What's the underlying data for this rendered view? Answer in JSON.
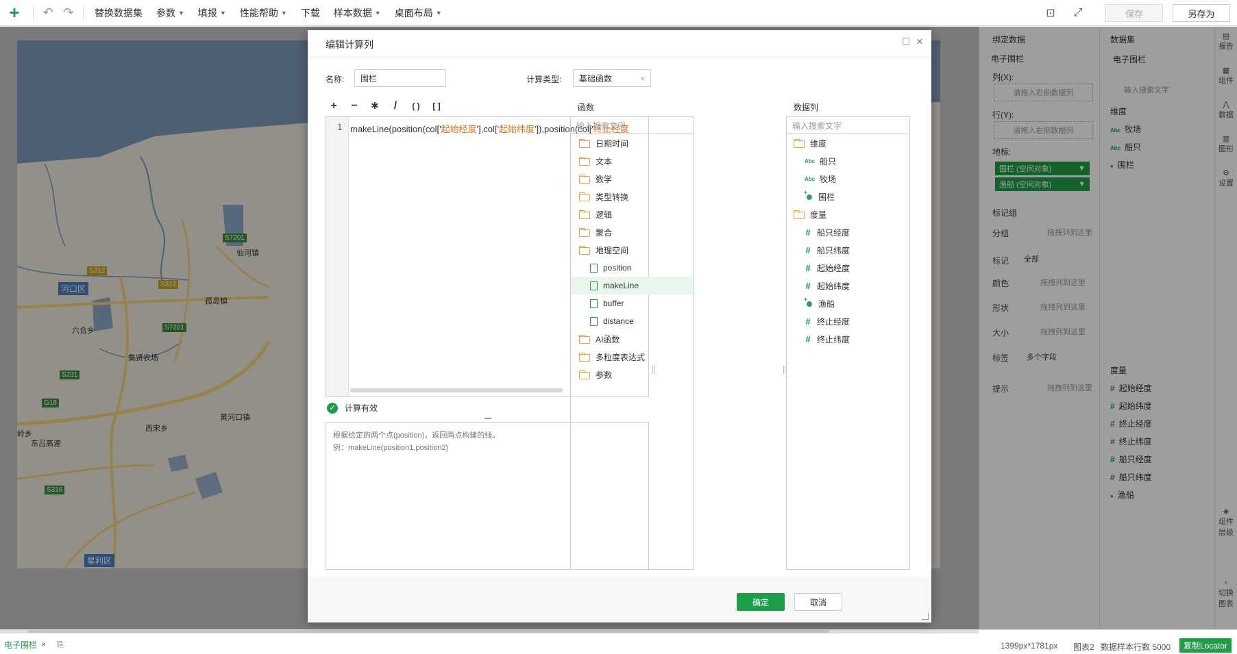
{
  "toolbar": {
    "menus": [
      "替换数据集",
      "参数",
      "填报",
      "性能帮助",
      "下载",
      "样本数据",
      "桌面布局"
    ],
    "save_label": "保存",
    "save_as_label": "另存为"
  },
  "map": {
    "district_labels": [
      "河口区",
      "星利区"
    ],
    "place_labels": [
      "仙河镇",
      "孤岛镇",
      "六合乡",
      "集贤农场",
      "西宋乡",
      "黄河口镇",
      "东吕高速",
      "岭乡"
    ],
    "road_badges": [
      "S312",
      "S312",
      "S7201",
      "S7201",
      "S231",
      "G18",
      "S316"
    ]
  },
  "bind_panel": {
    "title": "绑定数据",
    "component": "电子围栏",
    "col_label": "列(X):",
    "row_label": "行(Y):",
    "drop_hint": "请拖入右侧数据列",
    "geo_label": "地标:",
    "geo_chips": [
      "围栏 (空间对象)",
      "渔船 (空间对象)"
    ],
    "mark_group": "标记组",
    "group_label": "分组",
    "drag_here": "拖拽列到这里",
    "mark_label": "标记",
    "mark_value": "全部",
    "color_label": "颜色",
    "shape_label": "形状",
    "size_label": "大小",
    "tag_label": "标签",
    "tag_value": "多个字段",
    "tip_label": "提示"
  },
  "dataset_panel": {
    "title": "数据集",
    "selected": "电子围栏",
    "search_placeholder": "输入搜索文字",
    "dim_title": "维度",
    "dims": [
      "牧场",
      "船只",
      "围栏"
    ],
    "measure_title": "度量",
    "measures": [
      "起始经度",
      "起始纬度",
      "终止经度",
      "终止纬度",
      "船只经度",
      "船只纬度",
      "渔船"
    ]
  },
  "side_panel": {
    "items": [
      "报告",
      "组件",
      "数据",
      "图形",
      "设置",
      "组件层级",
      "切换图表"
    ]
  },
  "statusbar": {
    "tab": "电子围栏",
    "size": "1399px*1781px",
    "chart": "图表2",
    "rows": "数据样本行数 5000",
    "locator": "复制Locator"
  },
  "dialog": {
    "title": "编辑计算列",
    "name_label": "名称:",
    "name_value": "围栏",
    "type_label": "计算类型:",
    "type_value": "基础函数",
    "operators": [
      "+",
      "−",
      "∗",
      "/",
      "( )",
      "[ ]"
    ],
    "line_number": "1",
    "code_prefix": "makeLine(position(col['",
    "code_str1": "起始经度",
    "code_mid1": "'],col['",
    "code_str2": "起始纬度",
    "code_mid2": "']),position(col['",
    "code_str3": "终止经度",
    "valid_text": "计算有效",
    "desc_line1": "根据给定的两个点(position)，返回两点构建的线。",
    "desc_line2": "例：makeLine(position1,position2)",
    "func_title": "函数",
    "func_search": "输入搜索文字",
    "func_folders": [
      "日期时间",
      "文本",
      "数学",
      "类型转换",
      "逻辑",
      "聚合",
      "地理空间"
    ],
    "func_geo_items": [
      "position",
      "makeLine",
      "buffer",
      "distance"
    ],
    "func_folders_after": [
      "AI函数",
      "多粒度表达式",
      "参数"
    ],
    "data_title": "数据列",
    "data_search": "输入搜索文字",
    "data_dim_folder": "维度",
    "data_dims": [
      "船只",
      "牧场",
      "围栏"
    ],
    "data_measure_folder": "度量",
    "data_measures": [
      "船只经度",
      "船只纬度",
      "起始经度",
      "起始纬度",
      "渔船",
      "终止经度",
      "终止纬度"
    ],
    "ok_label": "确定",
    "cancel_label": "取消"
  }
}
